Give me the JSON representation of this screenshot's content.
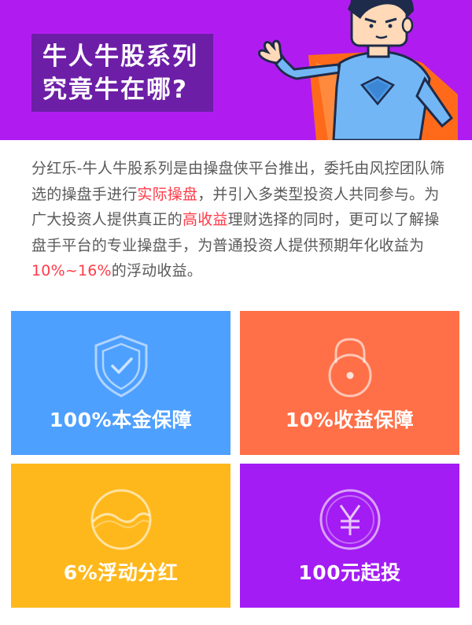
{
  "header": {
    "title_line1": "牛人牛股系列",
    "title_line2": "究竟牛在哪?"
  },
  "intro": {
    "part1": "分红乐-牛人牛股系列是由操盘侠平台推出，委托由风控团队筛选的操盘手进行",
    "highlight1": "实际操盘",
    "part2": "，并引入多类型投资人共同参与。为广大投资人提供真正的",
    "highlight2": "高收益",
    "part3": "理财选择的同时，更可以了解操盘手平台的专业操盘手，为普通投资人提供预期年化收益为",
    "highlight3": "10%~16%",
    "part4": "的浮动收益。"
  },
  "cards": [
    {
      "label": "100%本金保障",
      "icon": "shield-check-icon",
      "color": "#4ea0ff"
    },
    {
      "label": "10%收益保障",
      "icon": "padlock-icon",
      "color": "#ff7048"
    },
    {
      "label": "6%浮动分红",
      "icon": "wave-circle-icon",
      "color": "#ffb81c"
    },
    {
      "label": "100元起投",
      "icon": "yuan-coin-icon",
      "color": "#a31cf3"
    }
  ],
  "colors": {
    "banner": "#b01cf0",
    "title_box": "#6d1ea6",
    "highlight": "#ff3b48",
    "body_text": "#5a5a5a"
  }
}
